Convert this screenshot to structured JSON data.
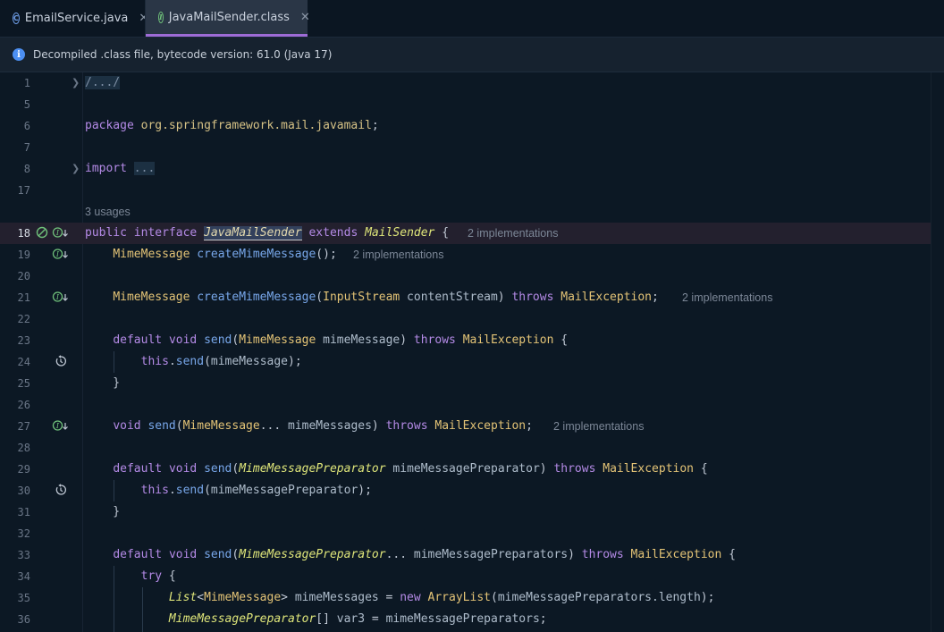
{
  "tabs": [
    {
      "label": "EmailService.java",
      "icon": "class-icon",
      "active": false
    },
    {
      "label": "JavaMailSender.class",
      "icon": "interface-icon",
      "active": true
    }
  ],
  "notice": {
    "text": "Decompiled .class file, bytecode version: 61.0 (Java 17)"
  },
  "hints": {
    "usages": "3 usages",
    "impl_18": "2 implementations",
    "impl_19": "2 implementations",
    "impl_21": "2 implementations",
    "impl_27": "2 implementations"
  },
  "line_numbers": [
    "1",
    "5",
    "6",
    "7",
    "8",
    "17",
    "18",
    "19",
    "20",
    "21",
    "22",
    "23",
    "24",
    "25",
    "26",
    "27",
    "28",
    "29",
    "30",
    "31",
    "32",
    "33",
    "34",
    "35",
    "36"
  ],
  "code": {
    "l1": "/.../",
    "l6_kw": "package",
    "l6_pkg": "org.springframework.mail.javamail",
    "l8_kw": "import",
    "l8_fold": "...",
    "l18_kw1": "public",
    "l18_kw2": "interface",
    "l18_name": "JavaMailSender",
    "l18_kw3": "extends",
    "l18_super": "MailSender",
    "l19_type": "MimeMessage",
    "l19_fn": "createMimeMessage",
    "l21_type": "MimeMessage",
    "l21_fn": "createMimeMessage",
    "l21_ptype": "InputStream",
    "l21_pname": "contentStream",
    "l21_throws": "throws",
    "l21_ex": "MailException",
    "l23_kw1": "default",
    "l23_kw2": "void",
    "l23_fn": "send",
    "l23_ptype": "MimeMessage",
    "l23_pname": "mimeMessage",
    "l23_throws": "throws",
    "l23_ex": "MailException",
    "l24_this": "this",
    "l24_fn": "send",
    "l24_arg": "mimeMessage",
    "l27_kw": "void",
    "l27_fn": "send",
    "l27_ptype": "MimeMessage",
    "l27_pname": "mimeMessages",
    "l27_throws": "throws",
    "l27_ex": "MailException",
    "l29_kw1": "default",
    "l29_kw2": "void",
    "l29_fn": "send",
    "l29_ptype": "MimeMessagePreparator",
    "l29_pname": "mimeMessagePreparator",
    "l29_throws": "throws",
    "l29_ex": "MailException",
    "l30_this": "this",
    "l30_fn": "send",
    "l30_arg": "mimeMessagePreparator",
    "l33_kw1": "default",
    "l33_kw2": "void",
    "l33_fn": "send",
    "l33_ptype": "MimeMessagePreparator",
    "l33_pname": "mimeMessagePreparators",
    "l33_throws": "throws",
    "l33_ex": "MailException",
    "l34_kw": "try",
    "l35_type": "List",
    "l35_gtype": "MimeMessage",
    "l35_var": "mimeMessages",
    "l35_new": "new",
    "l35_ctor": "ArrayList",
    "l35_arg": "mimeMessagePreparators.length",
    "l36_type": "MimeMessagePreparator",
    "l36_var": "var3",
    "l36_val": "mimeMessagePreparators"
  },
  "colors": {
    "accent": "#9e6cd6",
    "background": "#0c1824"
  }
}
